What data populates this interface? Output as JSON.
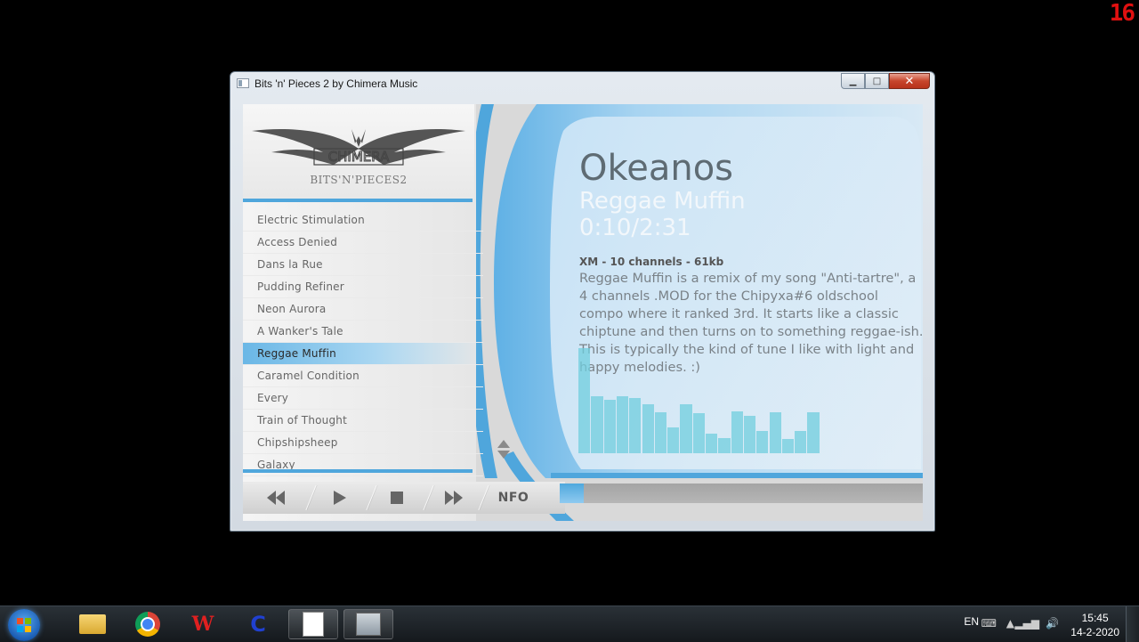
{
  "fps_counter": "16",
  "window": {
    "title": "Bits 'n' Pieces 2 by Chimera Music",
    "min_label": "▁",
    "max_label": "□",
    "close_label": "✕"
  },
  "logo": {
    "name": "CHIMERA",
    "subtitle": "BITS'N'PIECES2"
  },
  "tracks": [
    "Electric Stimulation",
    "Access Denied",
    "Dans la Rue",
    "Pudding Refiner",
    "Neon Aurora",
    "A Wanker's Tale",
    "Reggae Muffin",
    "Caramel Condition",
    "Every",
    "Train of Thought",
    "Chipshipsheep",
    "Galaxy"
  ],
  "active_track_index": 6,
  "info": {
    "artist": "Okeanos",
    "song": "Reggae Muffin",
    "time": "0:10/2:31",
    "meta": "XM - 10 channels - 61kb",
    "description": "Reggae Muffin is a remix of my song \"Anti-tartre\", a 4 channels .MOD for the Chipyxa#6 oldschool compo where it ranked 3rd. It starts like a classic chiptune and then turns on to something reggae-ish. This is typically the kind of tune I like with light and happy melodies. :)"
  },
  "visualizer_levels": [
    0.95,
    0.52,
    0.48,
    0.52,
    0.5,
    0.44,
    0.37,
    0.23,
    0.44,
    0.36,
    0.18,
    0.14,
    0.38,
    0.34,
    0.2,
    0.37,
    0.13,
    0.2,
    0.37
  ],
  "controls": {
    "nfo_label": "NFO",
    "progress": 0.066
  },
  "colors": {
    "accent_blue": "#4fa6dc",
    "visualizer": "#70cdde",
    "active_track": "#6ab7e6"
  },
  "taskbar": {
    "pinned": [
      "explorer-icon",
      "chrome-icon",
      "winamp-icon",
      "c64-icon",
      "notepad-icon",
      "player-icon"
    ],
    "language": "EN",
    "time": "15:45",
    "date": "14-2-2020"
  }
}
